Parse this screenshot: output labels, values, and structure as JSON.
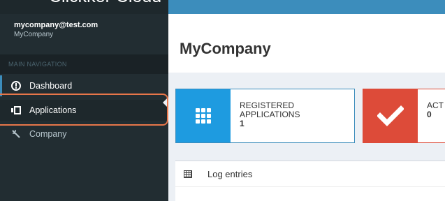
{
  "brand": {
    "name": "Clickker Cloud"
  },
  "user": {
    "email": "mycompany@test.com",
    "company": "MyCompany"
  },
  "navigation": {
    "header": "MAIN NAVIGATION",
    "items": [
      {
        "label": "Dashboard",
        "icon": "dashboard-icon"
      },
      {
        "label": "Applications",
        "icon": "applications-icon"
      },
      {
        "label": "Company",
        "icon": "wand-icon"
      }
    ]
  },
  "page": {
    "title": "MyCompany"
  },
  "info_boxes": [
    {
      "label_line1": "REGISTERED",
      "label_line2": "APPLICATIONS",
      "value": "1",
      "color": "#1e9be0",
      "icon": "grid-icon"
    },
    {
      "label_line1": "ACT",
      "value": "0",
      "color": "#dd4b39",
      "icon": "check-icon"
    }
  ],
  "log": {
    "title": "Log entries",
    "icon": "table-icon"
  },
  "colors": {
    "accent": "#3c8dbc",
    "sidebar": "#222d32",
    "highlight": "#e8764a"
  }
}
